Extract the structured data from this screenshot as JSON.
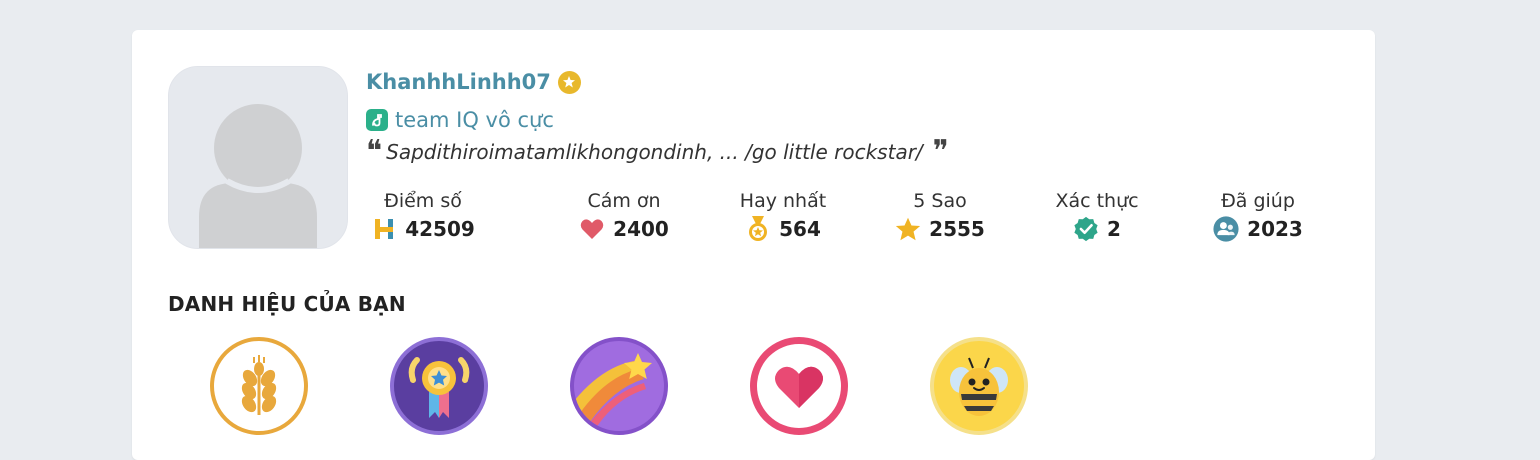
{
  "profile": {
    "username": "KhanhhLinhh07",
    "team": "team IQ vô cực",
    "bio": "Sapdithiroimatamlikhongondinh, ... /go little rockstar/"
  },
  "stats": [
    {
      "label": "Điểm số",
      "value": "42509",
      "icon": "points-icon"
    },
    {
      "label": "Cám ơn",
      "value": "2400",
      "icon": "heart-icon"
    },
    {
      "label": "Hay nhất",
      "value": "564",
      "icon": "medal-icon"
    },
    {
      "label": "5 Sao",
      "value": "2555",
      "icon": "star-icon"
    },
    {
      "label": "Xác thực",
      "value": "2",
      "icon": "verified-check-icon"
    },
    {
      "label": "Đã giúp",
      "value": "2023",
      "icon": "helped-users-icon"
    }
  ],
  "titles_section": {
    "heading": "DANH HIỆU CỦA BẠN",
    "badges": [
      {
        "icon": "wheat-badge-icon",
        "label": ""
      },
      {
        "icon": "award-ribbon-badge-icon",
        "label": ""
      },
      {
        "icon": "shooting-star-badge-icon",
        "label": ""
      },
      {
        "icon": "heart-badge-icon",
        "label": ""
      },
      {
        "icon": "bee-badge-icon",
        "label": ""
      }
    ]
  },
  "colors": {
    "accent": "#4a8ea5",
    "team_green": "#2bb08a",
    "gold": "#e8b82c",
    "heart_red": "#e05a68",
    "background": "#e9ecf0"
  }
}
